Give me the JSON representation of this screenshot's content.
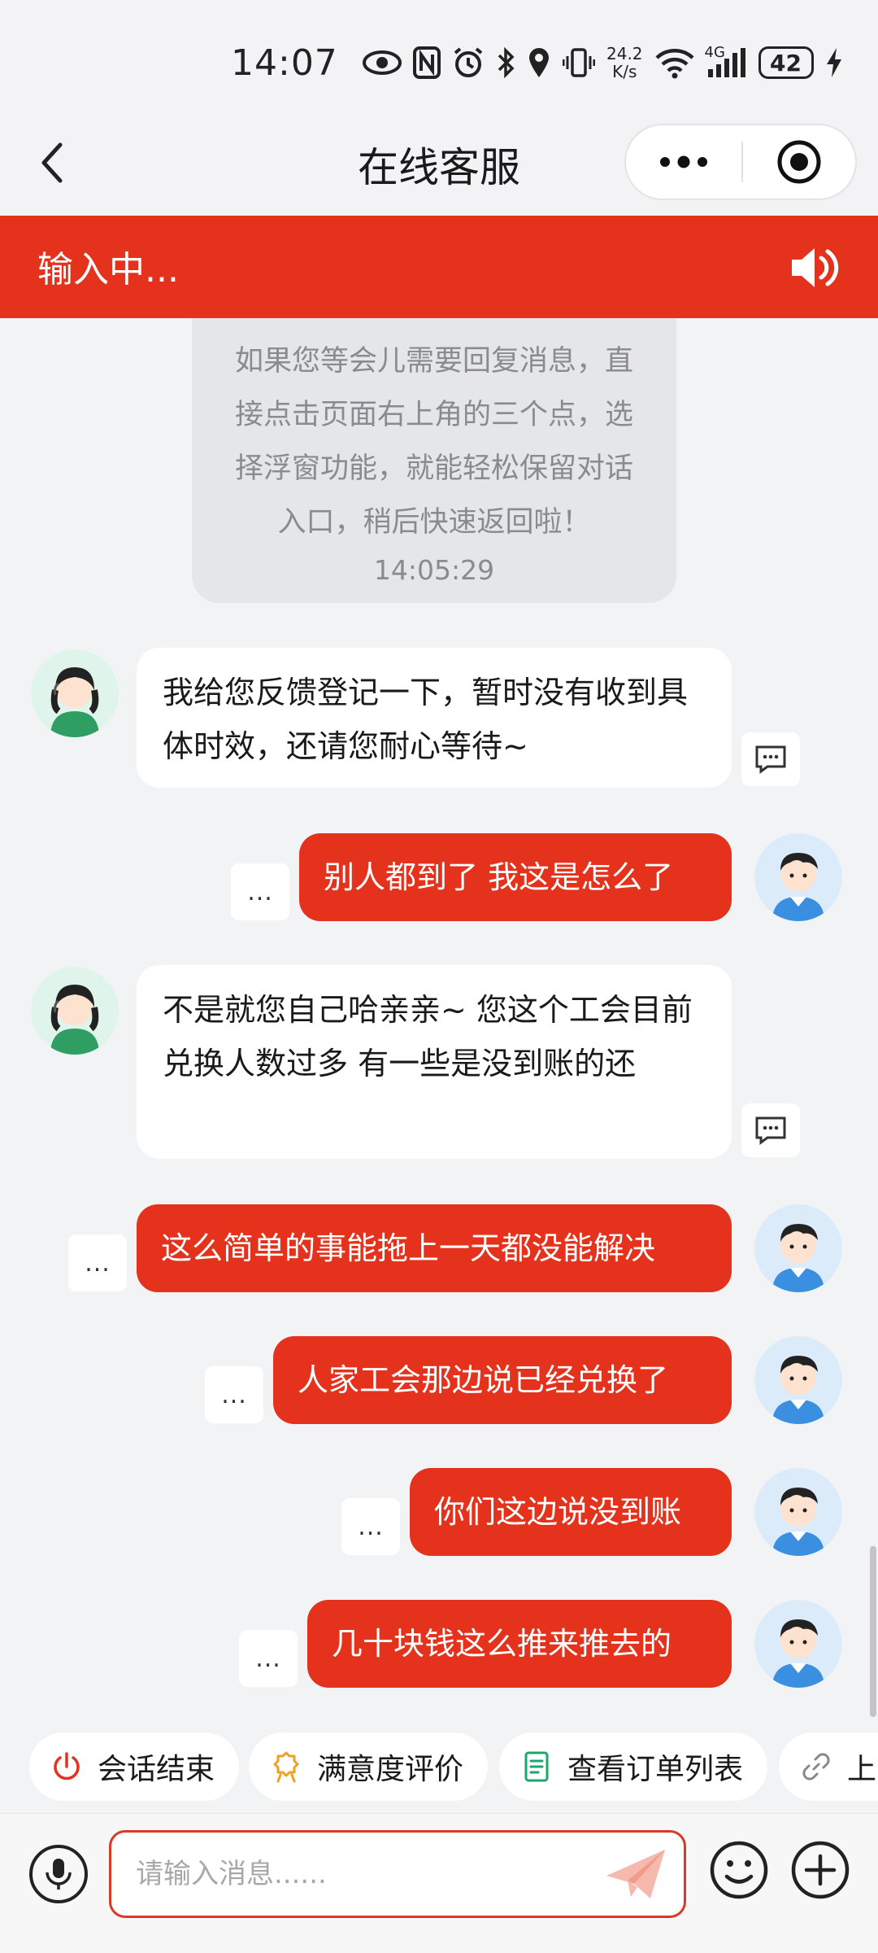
{
  "status_bar": {
    "time": "14:07",
    "net_speed_value": "24.2",
    "net_speed_unit": "K/s",
    "network": "4G",
    "battery": "42"
  },
  "nav": {
    "title": "在线客服",
    "more_label": "•••"
  },
  "typing_bar": {
    "text": "输入中..."
  },
  "system_message": {
    "text": "如果您等会儿需要回复消息，直接点击页面右上角的三个点，选择浮窗功能，就能轻松保留对话入口，稍后快速返回啦！",
    "time": "14:05:29"
  },
  "messages": [
    {
      "from": "agent",
      "text": "我给您反馈登记一下，暂时没有收到具体时效，还请您耐心等待~"
    },
    {
      "from": "user",
      "text": "别人都到了 我这是怎么了"
    },
    {
      "from": "agent",
      "text": "不是就您自己哈亲亲~ 您这个工会目前兑换人数过多 有一些是没到账的还"
    },
    {
      "from": "user",
      "text": "这么简单的事能拖上一天都没能解决"
    },
    {
      "from": "user",
      "text": "人家工会那边说已经兑换了"
    },
    {
      "from": "user",
      "text": "你们这边说没到账"
    },
    {
      "from": "user",
      "text": "几十块钱这么推来推去的"
    }
  ],
  "more_label": "...",
  "quick_actions": [
    {
      "label": "会话结束",
      "icon": "power-icon",
      "color": "#e4321c"
    },
    {
      "label": "满意度评价",
      "icon": "award-icon",
      "color": "#f0a020"
    },
    {
      "label": "查看订单列表",
      "icon": "document-icon",
      "color": "#1aa86a"
    },
    {
      "label": "上",
      "icon": "link-icon",
      "color": "#888888"
    }
  ],
  "input": {
    "placeholder": "请输入消息......"
  },
  "colors": {
    "brand_red": "#e4321c",
    "agent_bubble": "#ffffff",
    "background": "#f2f3f5"
  }
}
